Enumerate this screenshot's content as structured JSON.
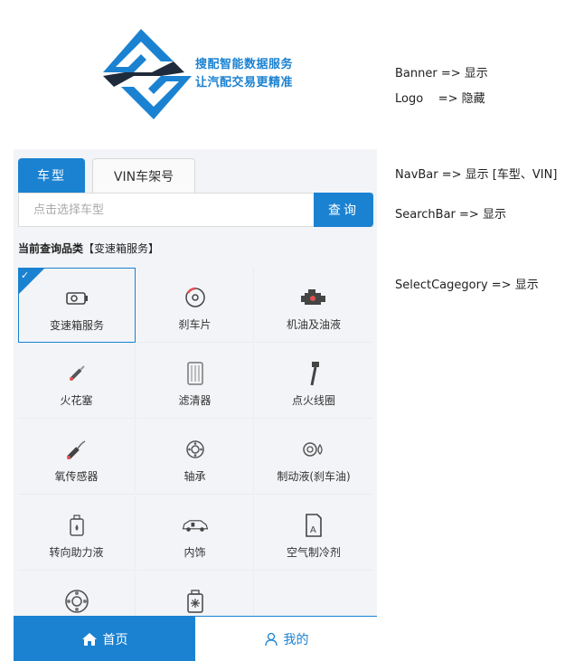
{
  "banner": {
    "slogan_line1": "搜配智能数据服务",
    "slogan_line2": "让汽配交易更精准",
    "logo_icon": "stylized-s-logo-icon"
  },
  "notes": {
    "banner": "Banner => 显示",
    "logo": "Logo    => 隐藏",
    "navbar": "NavBar => 显示 [车型、VIN]",
    "searchbar": "SearchBar => 显示",
    "selectcategory": "SelectCagegory => 显示"
  },
  "tabs": {
    "car": "车型",
    "vin": "VIN车架号"
  },
  "search": {
    "placeholder": "点击选择车型",
    "button": "查询"
  },
  "category": {
    "prefix": "当前查询品类",
    "value": "【变速箱服务】"
  },
  "grid": [
    {
      "label": "变速箱服务",
      "icon": "transmission-icon",
      "selected": true
    },
    {
      "label": "刹车片",
      "icon": "brake-disc-icon"
    },
    {
      "label": "机油及油液",
      "icon": "engine-oil-icon"
    },
    {
      "label": "火花塞",
      "icon": "spark-plug-icon"
    },
    {
      "label": "滤清器",
      "icon": "filter-icon"
    },
    {
      "label": "点火线圈",
      "icon": "ignition-coil-icon"
    },
    {
      "label": "氧传感器",
      "icon": "oxygen-sensor-icon"
    },
    {
      "label": "轴承",
      "icon": "bearing-icon"
    },
    {
      "label": "制动液(刹车油)",
      "icon": "brake-fluid-icon"
    },
    {
      "label": "转向助力液",
      "icon": "steering-fluid-icon"
    },
    {
      "label": "内饰",
      "icon": "car-interior-icon"
    },
    {
      "label": "空气制冷剂",
      "icon": "refrigerant-icon"
    },
    {
      "label": "",
      "icon": "wheel-bearing-icon"
    },
    {
      "label": "",
      "icon": "coolant-icon"
    },
    {
      "label": "",
      "icon": ""
    }
  ],
  "bottom_nav": {
    "home": "首页",
    "mine": "我的"
  },
  "colors": {
    "accent": "#1b82d1",
    "logo_dark": "#1f2a3a"
  }
}
